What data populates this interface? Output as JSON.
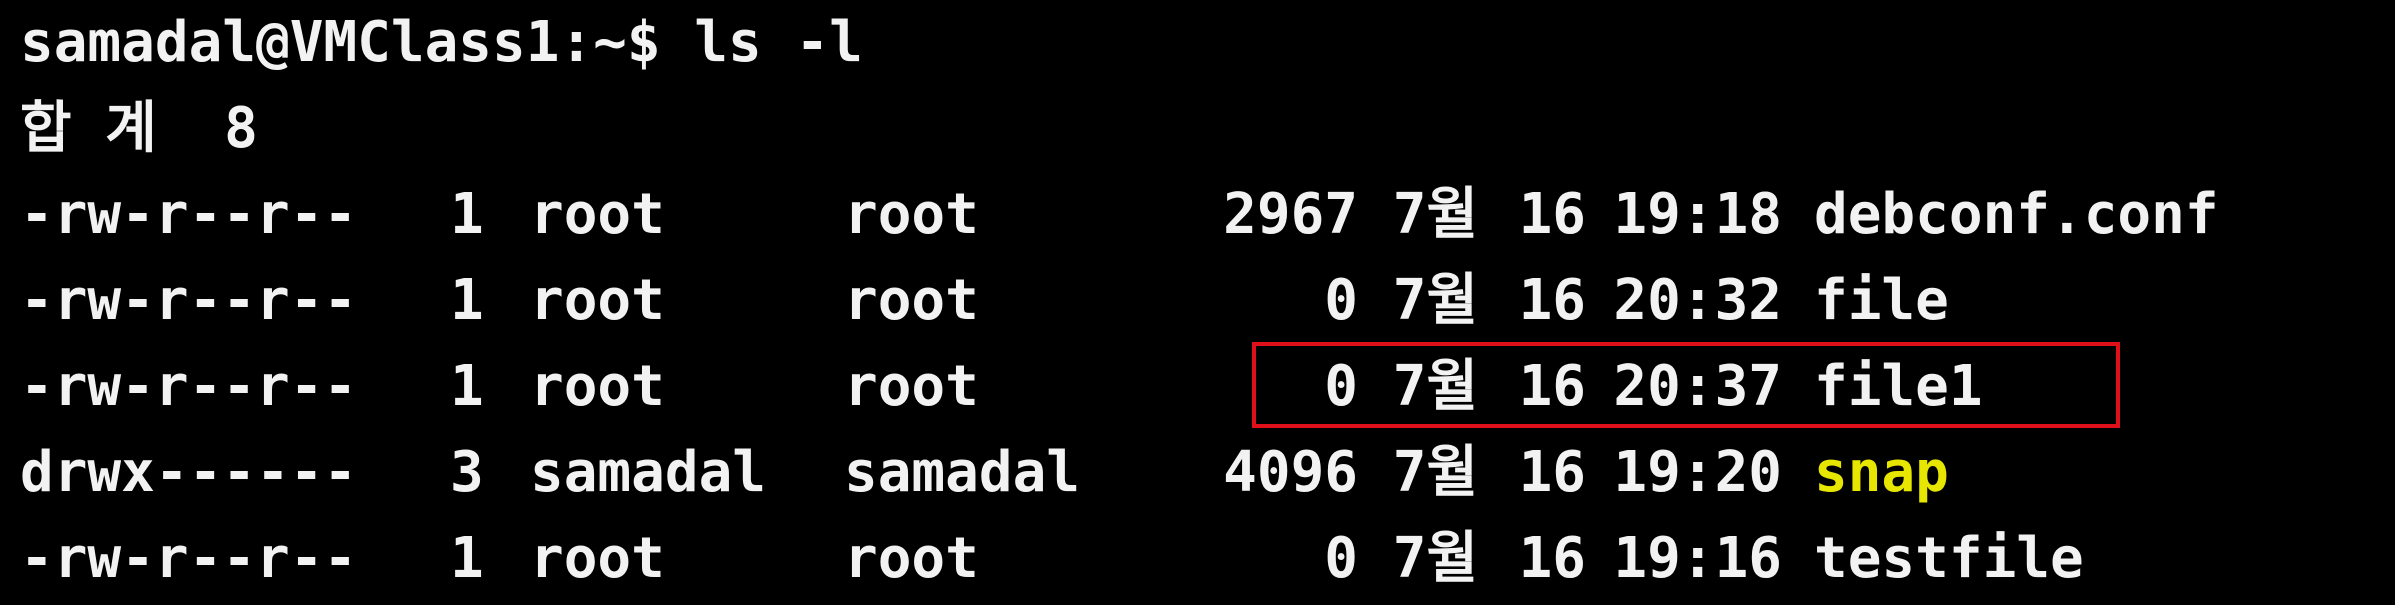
{
  "terminal": {
    "prompt": "samadal@VMClass1:~$ ls -l",
    "total": "합 계  8",
    "colors": {
      "background": "#000000",
      "text": "#f2f2f2",
      "directory": "#e6e600",
      "highlight_border": "#e0101a"
    },
    "entries": [
      {
        "perm": "-rw-r--r--",
        "links": "1",
        "owner": "root",
        "group": "root",
        "size": "2967",
        "month": "7월",
        "day": "16",
        "time": "19:18",
        "name": "debconf.conf",
        "type": "file"
      },
      {
        "perm": "-rw-r--r--",
        "links": "1",
        "owner": "root",
        "group": "root",
        "size": "0",
        "month": "7월",
        "day": "16",
        "time": "20:32",
        "name": "file",
        "type": "file"
      },
      {
        "perm": "-rw-r--r--",
        "links": "1",
        "owner": "root",
        "group": "root",
        "size": "0",
        "month": "7월",
        "day": "16",
        "time": "20:37",
        "name": "file1",
        "type": "file",
        "highlighted": true
      },
      {
        "perm": "drwx------",
        "links": "3",
        "owner": "samadal",
        "group": "samadal",
        "size": "4096",
        "month": "7월",
        "day": "16",
        "time": "19:20",
        "name": "snap",
        "type": "directory"
      },
      {
        "perm": "-rw-r--r--",
        "links": "1",
        "owner": "root",
        "group": "root",
        "size": "0",
        "month": "7월",
        "day": "16",
        "time": "19:16",
        "name": "testfile",
        "type": "file"
      }
    ]
  }
}
